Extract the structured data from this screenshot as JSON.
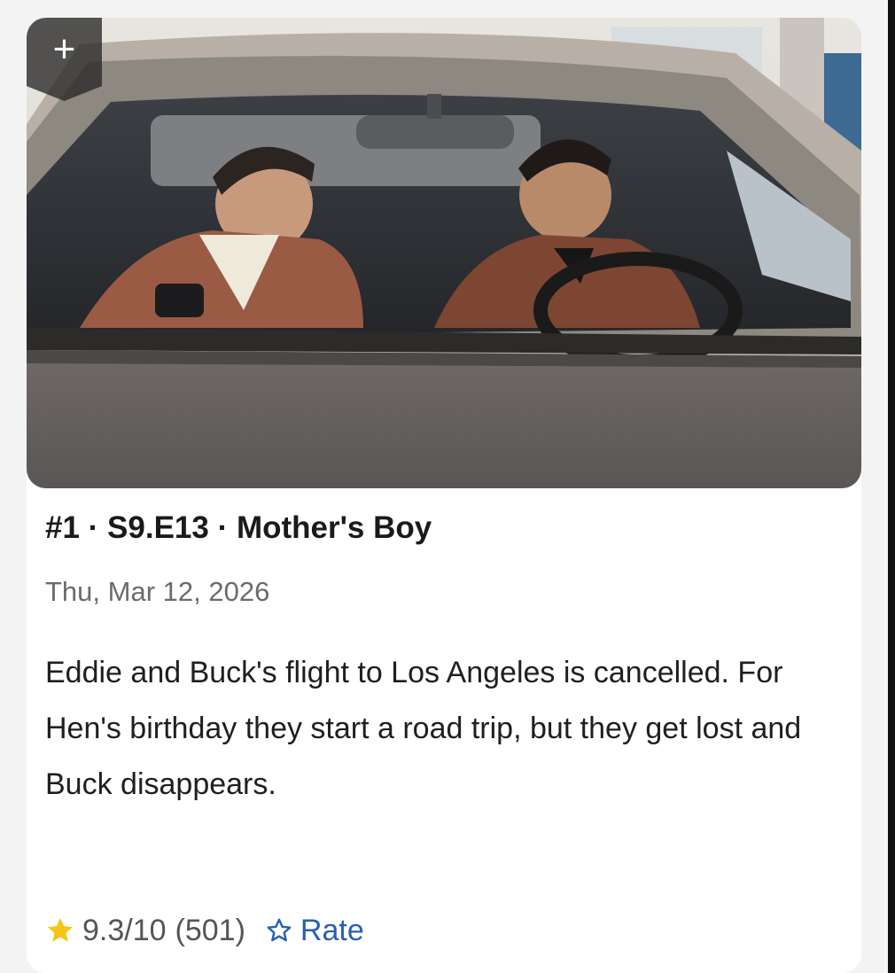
{
  "episode": {
    "rank": "#1",
    "separator": "·",
    "code": "S9.E13",
    "name": "Mother's Boy",
    "heading": "#1 · S9.E13 · Mother's Boy",
    "air_date": "Thu, Mar 12, 2026",
    "description": "Eddie and Buck's flight to Los Angeles is cancelled. For Hen's birthday they start a road trip, but they get lost and Buck disappears."
  },
  "rating": {
    "value_text": "9.3/10",
    "count_text": "(501)",
    "rate_label": "Rate"
  },
  "icons": {
    "add": "plus-icon",
    "rating_star": "star-filled-icon",
    "rate_star": "star-outline-icon"
  },
  "colors": {
    "accent_blue": "#2a5fb0",
    "star_gold": "#f5c518"
  }
}
